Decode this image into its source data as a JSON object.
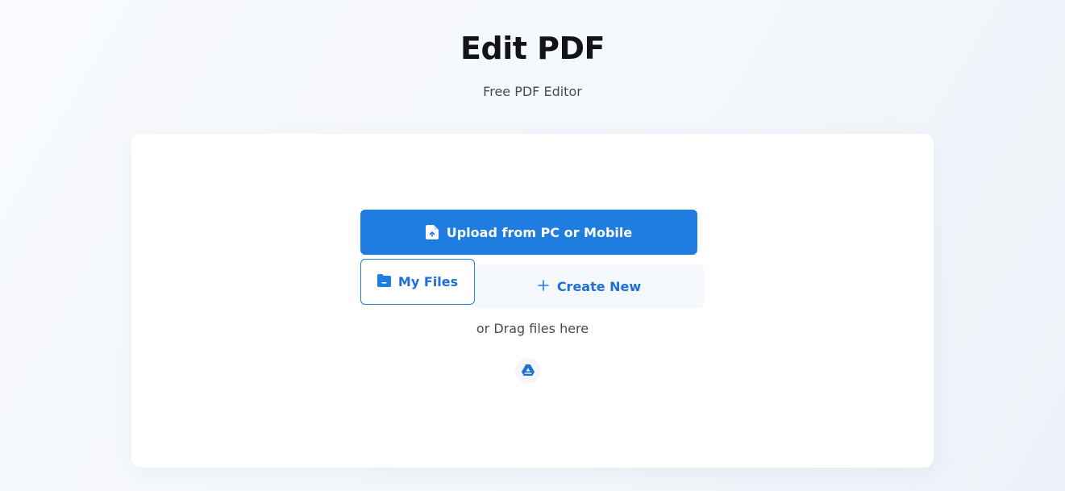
{
  "header": {
    "title": "Edit PDF",
    "subtitle": "Free PDF Editor"
  },
  "upload": {
    "upload_label": "Upload from PC or Mobile",
    "my_files_label": "My Files",
    "create_new_label": "Create New",
    "drag_hint": "or Drag files here",
    "icons": {
      "upload": "file-upload-icon",
      "my_files": "folder-icon",
      "create_new": "plus-icon",
      "cloud": "google-drive-icon"
    }
  },
  "colors": {
    "accent": "#1f7de0",
    "accent_text": "#1f6fd1",
    "background": "#f6f8fc",
    "card": "#ffffff"
  }
}
